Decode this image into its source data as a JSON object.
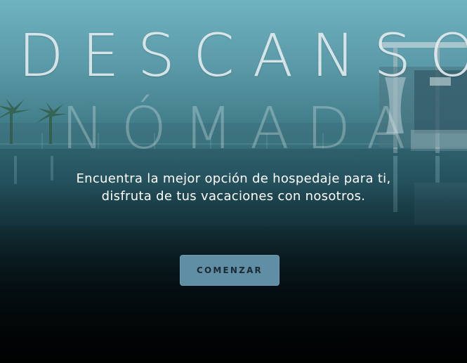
{
  "hero": {
    "title_line_1": "DESCANSO",
    "title_line_2": "NÓMADA",
    "subtitle": "Encuentra la mejor opción de hospedaje para ti, disfruta de tus vacaciones con nosotros.",
    "cta_label": "COMENZAR"
  },
  "colors": {
    "button_bg": "#5f8ea5",
    "button_text": "#1b2a32",
    "sky": "#6fb2c0",
    "bottom": "#03090b"
  }
}
